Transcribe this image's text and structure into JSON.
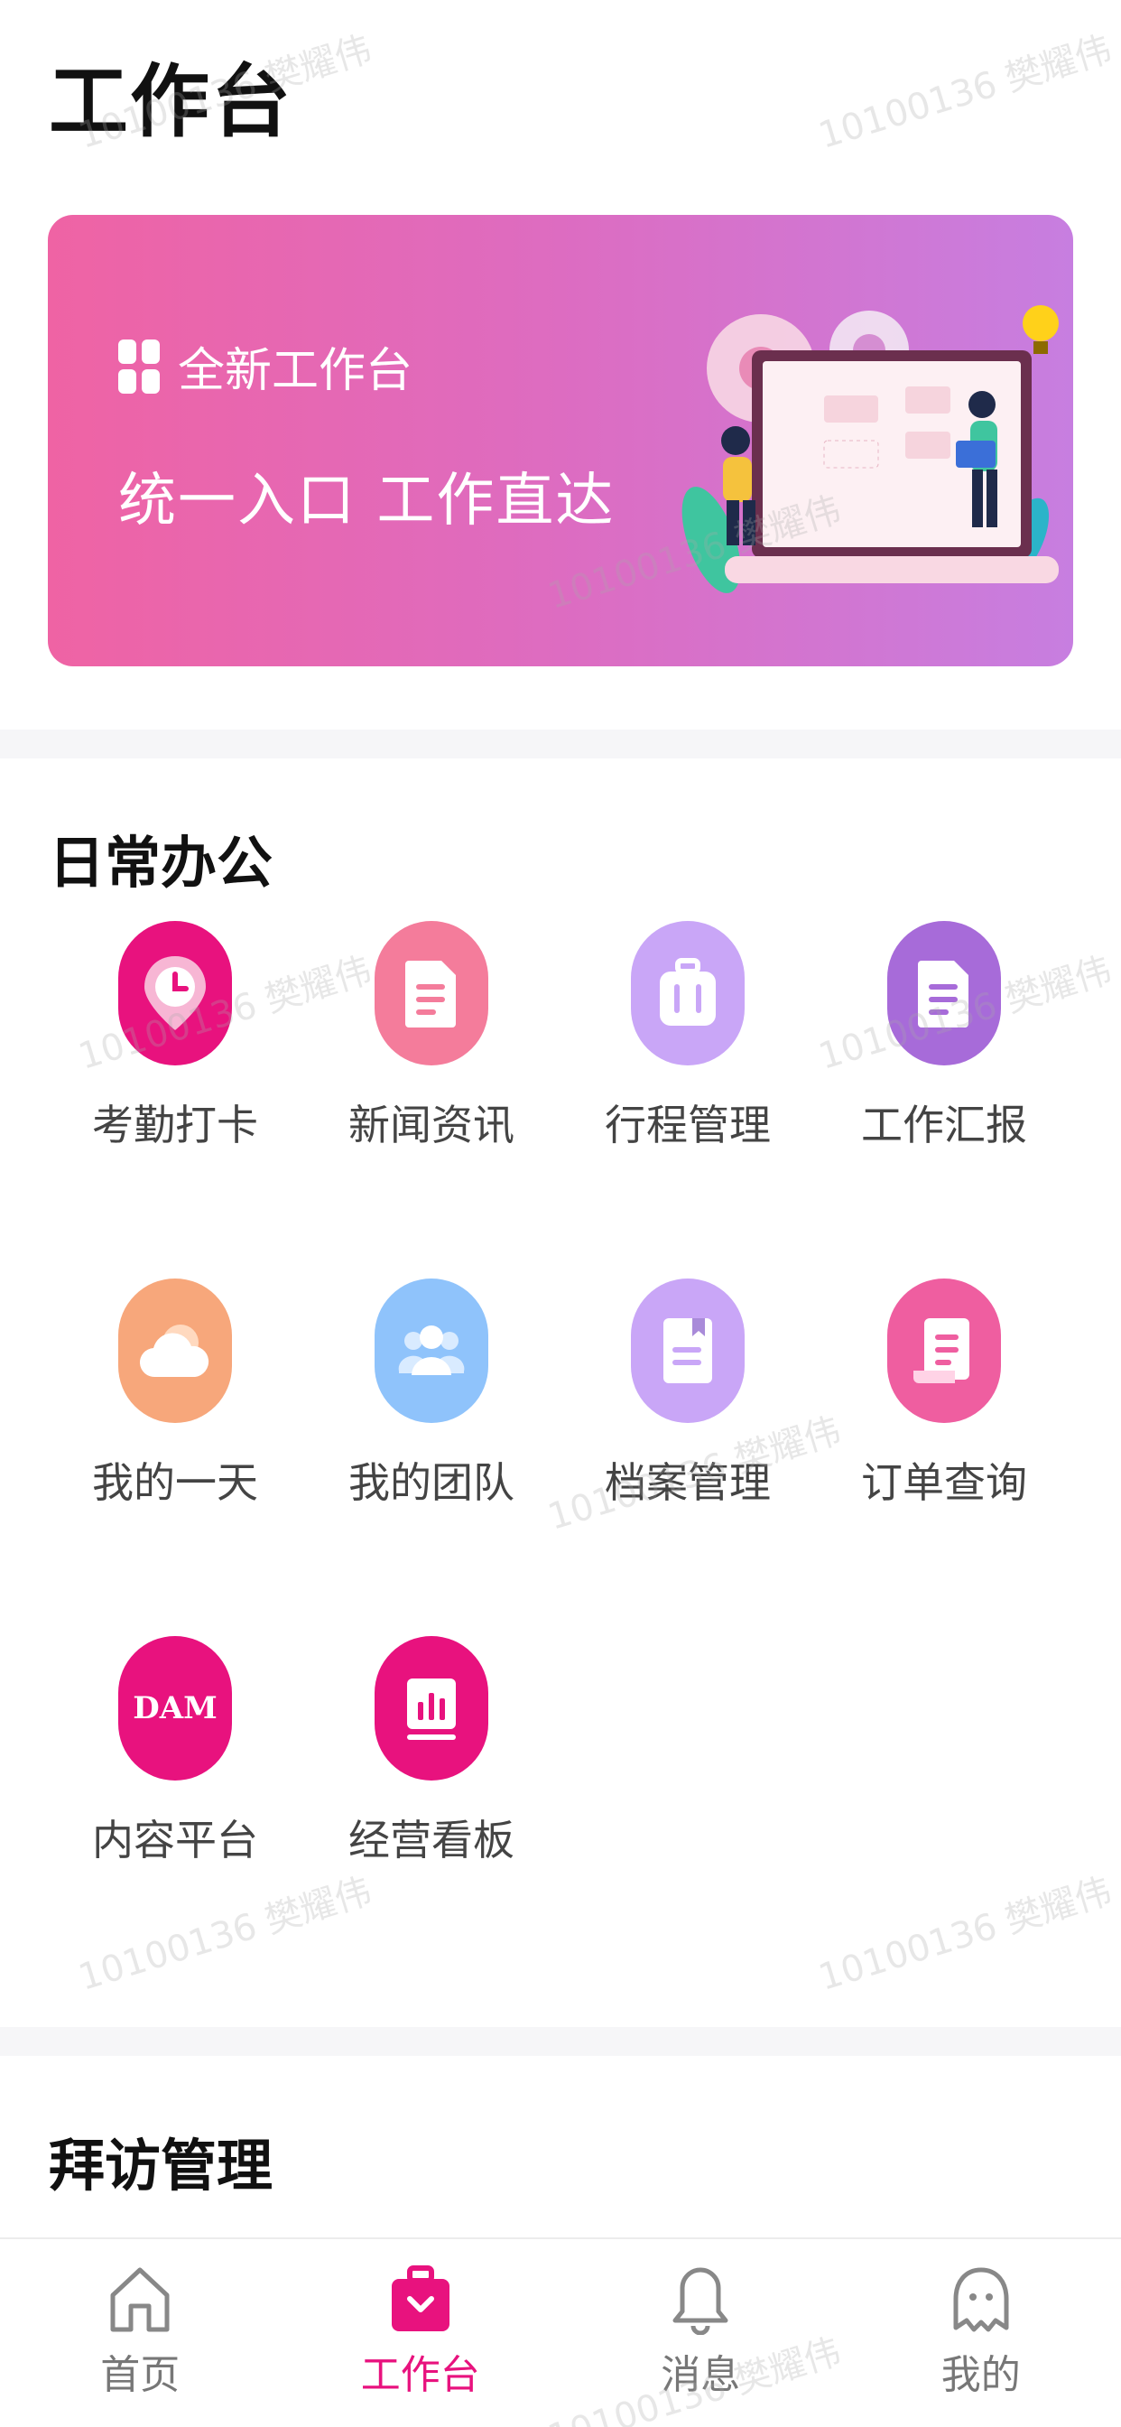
{
  "header": {
    "title": "工作台"
  },
  "banner": {
    "tag": "全新工作台",
    "slogan": "统一入口 工作直达"
  },
  "sections": {
    "daily": {
      "title": "日常办公"
    },
    "visit": {
      "title": "拜访管理"
    }
  },
  "apps": [
    {
      "label": "考勤打卡",
      "icon": "location-clock-icon",
      "color": "#e8127e"
    },
    {
      "label": "新闻资讯",
      "icon": "document-icon",
      "color": "#f47c9b"
    },
    {
      "label": "行程管理",
      "icon": "luggage-icon",
      "color": "#c9a6f7"
    },
    {
      "label": "工作汇报",
      "icon": "report-icon",
      "color": "#a76bd9"
    },
    {
      "label": "我的一天",
      "icon": "weather-icon",
      "color": "#f7a77b"
    },
    {
      "label": "我的团队",
      "icon": "team-icon",
      "color": "#8fc3fb"
    },
    {
      "label": "档案管理",
      "icon": "archive-icon",
      "color": "#c9a6f7"
    },
    {
      "label": "订单查询",
      "icon": "scroll-icon",
      "color": "#ef5ea0"
    },
    {
      "label": "内容平台",
      "icon": "dam-icon",
      "icon_text": "DAM",
      "color": "#e8127e"
    },
    {
      "label": "经营看板",
      "icon": "dashboard-icon",
      "color": "#e8127e"
    }
  ],
  "tabbar": {
    "items": [
      {
        "label": "首页",
        "icon": "home-icon",
        "active": false
      },
      {
        "label": "工作台",
        "icon": "briefcase-icon",
        "active": true
      },
      {
        "label": "消息",
        "icon": "bell-icon",
        "active": false
      },
      {
        "label": "我的",
        "icon": "profile-icon",
        "active": false
      }
    ]
  },
  "watermark": {
    "text": "10100136 樊耀伟"
  },
  "colors": {
    "accent": "#e8127e",
    "band": "#f6f6f8"
  }
}
